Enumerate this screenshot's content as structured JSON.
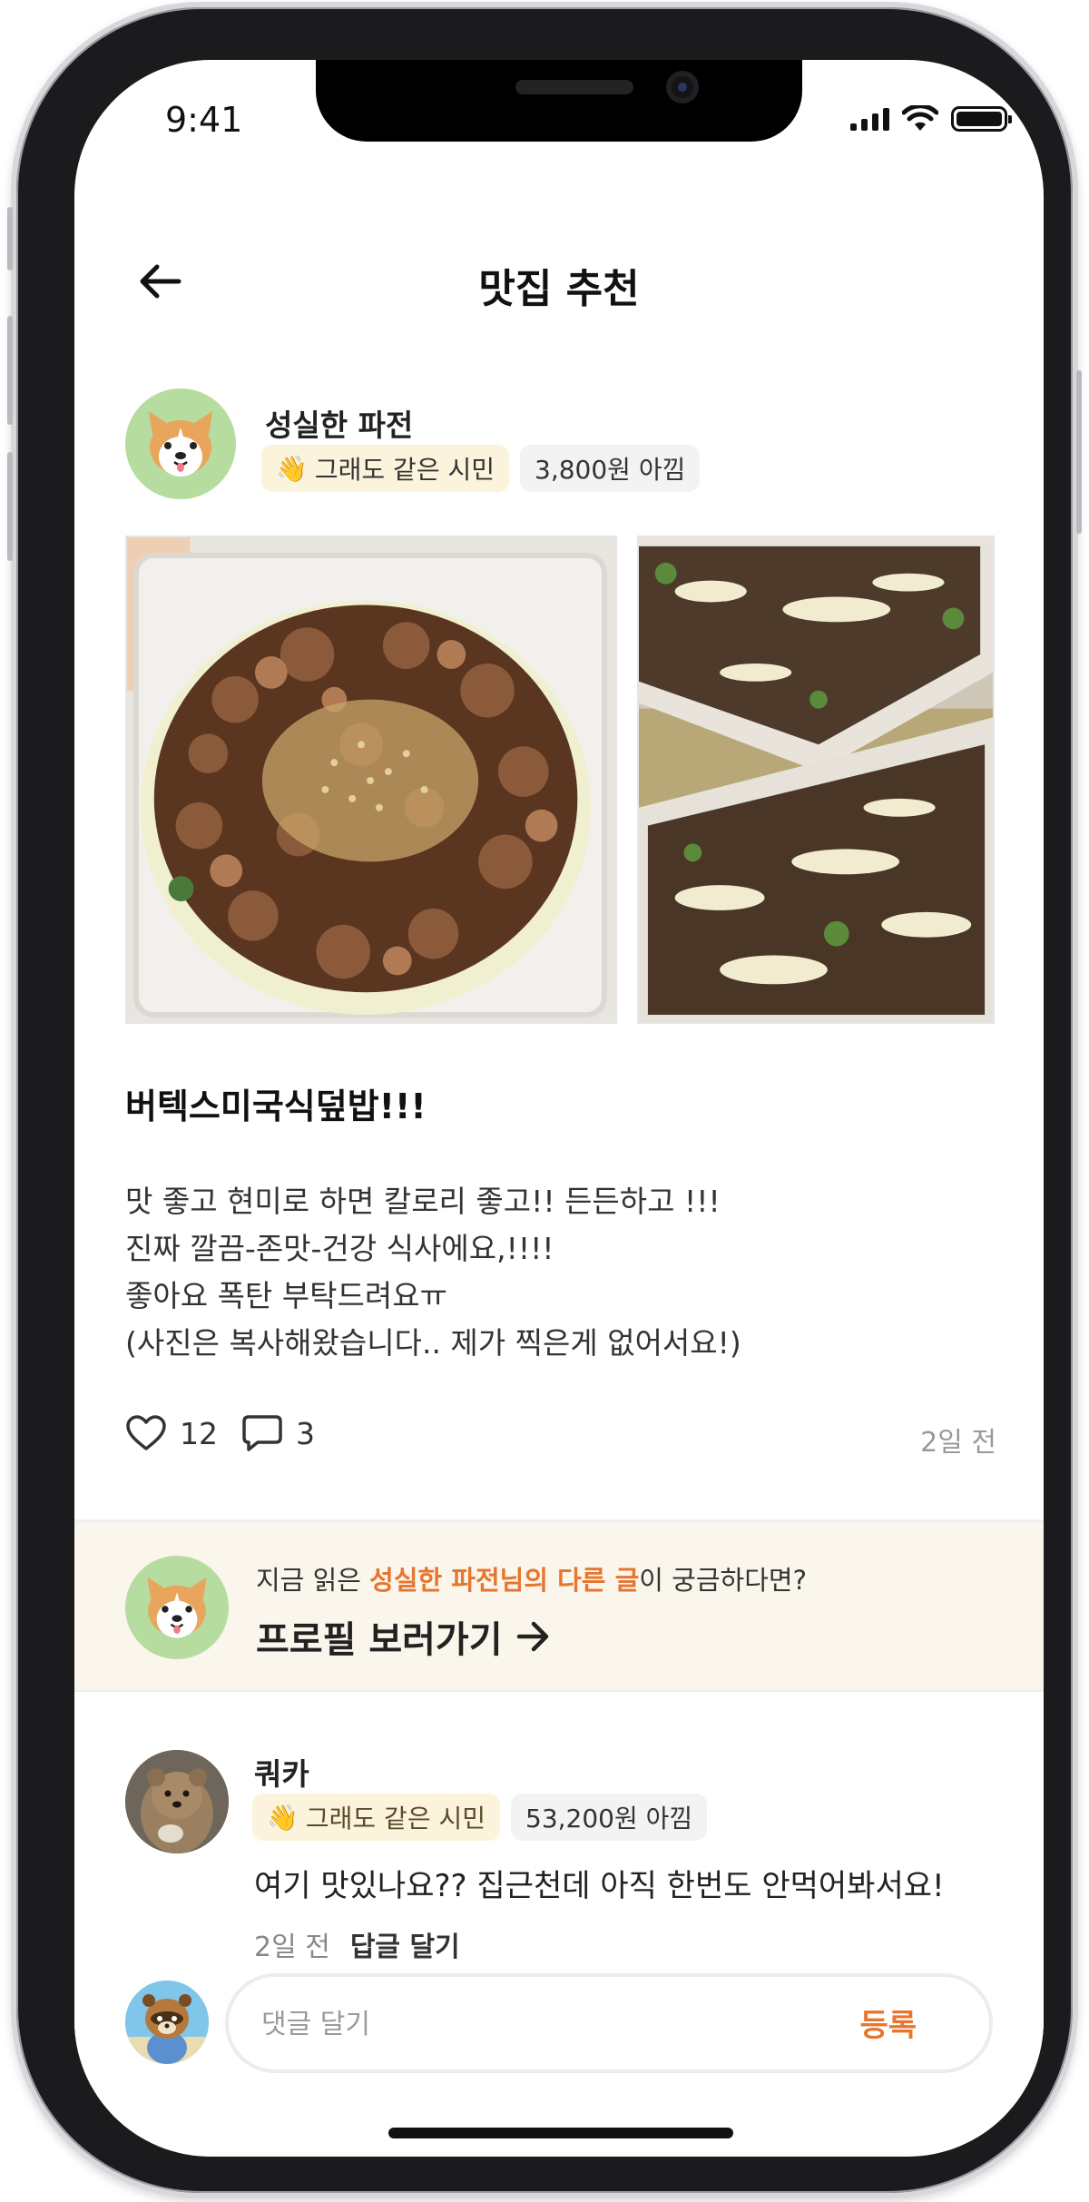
{
  "status_bar": {
    "time": "9:41"
  },
  "header": {
    "title": "맛집 추천"
  },
  "post": {
    "author": {
      "name": "성실한 파전",
      "badge_citizen": "그래도 같은 시민",
      "badge_saved": "3,800원 아낌"
    },
    "photos": [
      "grilled-chicken-sesame-bowl",
      "chicken-mayo-containers"
    ],
    "title": "버텍스미국식덮밥!!!",
    "body_lines": [
      "맛 좋고 현미로 하면 칼로리 좋고!! 든든하고 !!!",
      "진짜 깔끔-존맛-건강 식사에요,!!!!",
      "좋아요 폭탄 부탁드려요ㅠ",
      "(사진은 복사해왔습니다.. 제가 찍은게 없어서요!)"
    ],
    "likes": "12",
    "comments": "3",
    "time": "2일 전"
  },
  "profile_banner": {
    "prefix": "지금 읽은 ",
    "highlight": "성실한 파전님의 다른 글",
    "suffix": "이 궁금하다면?",
    "cta": "프로필 보러가기"
  },
  "comment": {
    "author": "쿼카",
    "badge_citizen": "그래도 같은 시민",
    "badge_saved": "53,200원 아낌",
    "text": "여기 맛있나요?? 집근천데 아직 한번도 안먹어봐서요!",
    "time": "2일 전",
    "reply_label": "답글 달기"
  },
  "composer": {
    "placeholder": "댓글 달기",
    "submit_label": "등록"
  },
  "colors": {
    "accent": "#e7752e",
    "banner_bg": "#fbf6eb",
    "badge_citizen_bg": "#fbf3dc",
    "badge_saved_bg": "#f3f3f3",
    "avatar_green": "#b6dca0"
  }
}
